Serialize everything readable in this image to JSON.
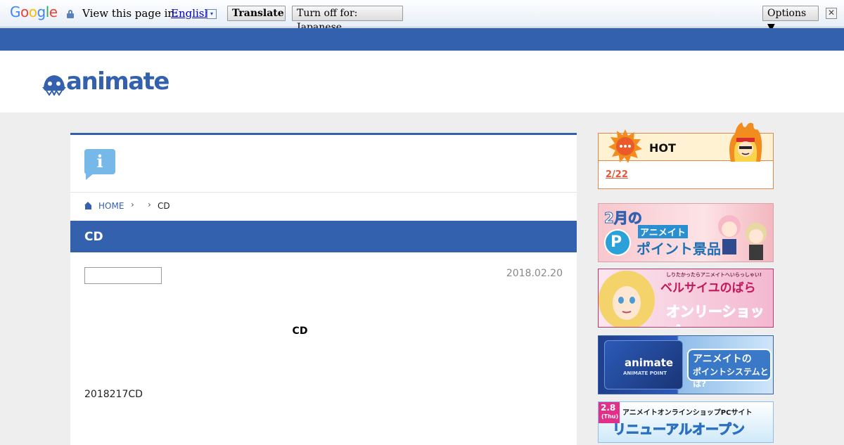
{
  "translate_bar": {
    "logo_letters": [
      "G",
      "o",
      "o",
      "g",
      "l",
      "e"
    ],
    "prompt": "View this page in:",
    "language": "English",
    "language_caret": "▾",
    "translate_label": "Translate",
    "turn_off_label": "Turn off for: Japanese",
    "options_label": "Options ▼",
    "close_glyph": "✕"
  },
  "header": {
    "logo_text": "animate",
    "colors": {
      "brand_blue": "#3361ae"
    }
  },
  "info_icon": {
    "glyph": "i",
    "color": "#76b8e8"
  },
  "breadcrumb": {
    "home": "HOME",
    "separator": "›",
    "current": "CD"
  },
  "article": {
    "title": "CD",
    "date": "2018.02.20",
    "heading": "CD",
    "body": "2018217CD"
  },
  "sidebar": {
    "hot": {
      "label": "HOT",
      "date_link": "2/22",
      "accent": "#e2874a"
    },
    "banners": [
      {
        "line1": "2月の",
        "line2": "アニメイト",
        "line3": "ポイント景品",
        "badge": "Point"
      },
      {
        "line1": "しりたかったらアニメイトへいらっしゃい!",
        "line2": "ベルサイユのばら",
        "line3": "オンリーショップ"
      },
      {
        "line1": "animate",
        "line2": "ANIMATE POINT",
        "line3": "アニメイトの",
        "line4": "ポイントシステムとは?"
      },
      {
        "badge": "2.8",
        "badge_sub": "(Thu)",
        "line1": "アニメイトオンラインショップPCサイト",
        "line2": "リニューアルオープン"
      }
    ]
  }
}
